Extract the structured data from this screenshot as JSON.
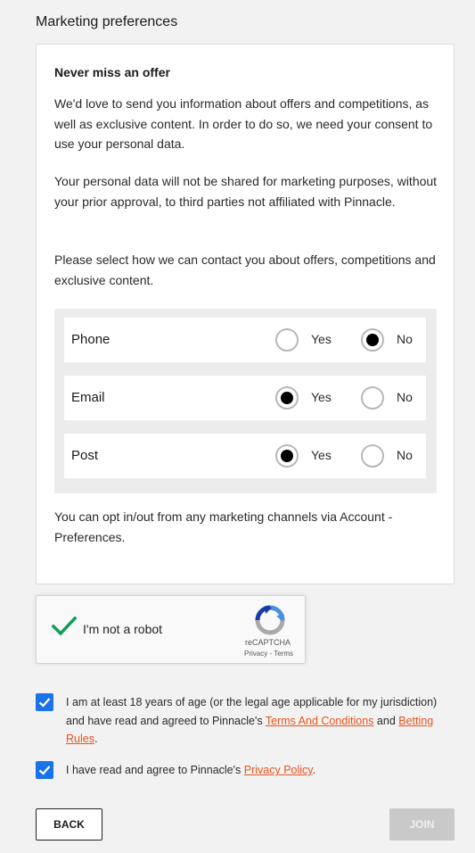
{
  "section": {
    "title": "Marketing preferences"
  },
  "card": {
    "heading": "Never miss an offer",
    "paragraph_1": "We'd love to send you information about offers and competitions, as well as exclusive content. In order to do so, we need your consent to use your personal data.",
    "paragraph_2": "Your personal data will not be shared for marketing purposes, without your prior approval, to third parties not affiliated with Pinnacle.",
    "paragraph_3": "Please select how we can contact you about offers, competitions and exclusive content.",
    "footer_note": "You can opt in/out from any marketing channels via Account - Preferences."
  },
  "preferences": {
    "yes_label": "Yes",
    "no_label": "No",
    "rows": [
      {
        "label": "Phone",
        "selected": "No"
      },
      {
        "label": "Email",
        "selected": "Yes"
      },
      {
        "label": "Post",
        "selected": "Yes"
      }
    ]
  },
  "recaptcha": {
    "label": "I'm not a robot",
    "brand": "reCAPTCHA",
    "privacy": "Privacy",
    "separator": " - ",
    "terms": "Terms",
    "checked": true,
    "check_color": "#0f9d58"
  },
  "consents": {
    "age": {
      "checked": true,
      "text_before": "I am at least 18 years of age (or the legal age applicable for my jurisdiction) and have read and agreed to Pinnacle's ",
      "link_terms": "Terms And Conditions",
      "text_and": " and ",
      "link_betting": "Betting Rules",
      "text_end": "."
    },
    "privacy": {
      "checked": true,
      "text_before": "I have read and agree to Pinnacle's ",
      "link_privacy": "Privacy Policy",
      "text_end": "."
    }
  },
  "buttons": {
    "back": "BACK",
    "join": "JOIN"
  },
  "colors": {
    "accent_blue": "#1a73e8",
    "link_orange": "#e8541c",
    "join_disabled": "#c9c9c9"
  }
}
